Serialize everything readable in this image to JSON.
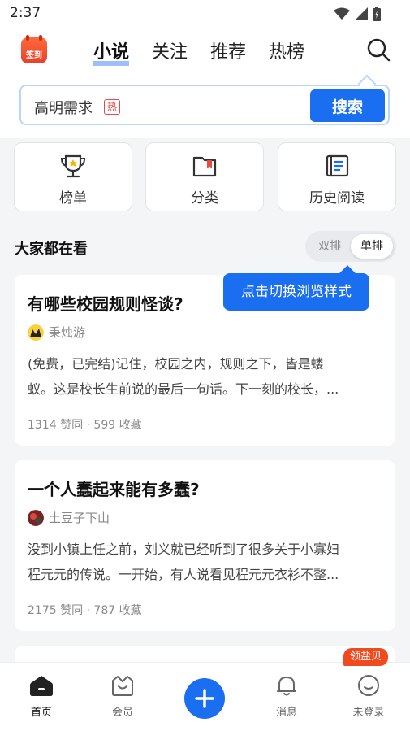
{
  "status_bar": {
    "time": "2:37"
  },
  "header": {
    "checkin_label": "签到",
    "tabs": [
      {
        "label": "小说",
        "active": true
      },
      {
        "label": "关注",
        "active": false
      },
      {
        "label": "推荐",
        "active": false
      },
      {
        "label": "热榜",
        "active": false
      }
    ]
  },
  "search": {
    "query": "高明需求",
    "hot_badge": "热",
    "button": "搜索"
  },
  "quick_links": [
    {
      "label": "榜单",
      "icon": "trophy-icon"
    },
    {
      "label": "分类",
      "icon": "folder-bookmark-icon"
    },
    {
      "label": "历史阅读",
      "icon": "history-book-icon"
    }
  ],
  "section": {
    "title": "大家都在看",
    "toggle_double": "双排",
    "toggle_single": "单排",
    "selected": "单排"
  },
  "tooltip": "点击切换浏览样式",
  "cards": [
    {
      "title": "有哪些校园规则怪谈?",
      "author": "秉烛游",
      "excerpt_lines": [
        "(免费，已完结)记住，校园之内，规则之下，皆是蝼",
        "蚁。这是校长生前说的最后一句话。下一刻的校长，..."
      ],
      "meta": "1314 赞同 · 599 收藏"
    },
    {
      "title": "一个人蠢起来能有多蠢?",
      "author": "土豆子下山",
      "excerpt_lines": [
        "没到小镇上任之前，刘义就已经听到了很多关于小寡妇",
        "程元元的传说。一开始，有人说看见程元元衣衫不整..."
      ],
      "meta": "2175 赞同 · 787 收藏"
    }
  ],
  "bottom_nav": {
    "items": [
      {
        "label": "首页",
        "icon": "home-icon",
        "active": true
      },
      {
        "label": "会员",
        "icon": "vip-crown-icon",
        "active": false
      },
      {
        "label": "消息",
        "icon": "bell-icon",
        "active": false
      },
      {
        "label": "未登录",
        "icon": "profile-icon",
        "active": false
      }
    ],
    "promo_badge": "领盐贝"
  },
  "colors": {
    "accent": "#1a6ef0",
    "badge": "#f04a20"
  }
}
